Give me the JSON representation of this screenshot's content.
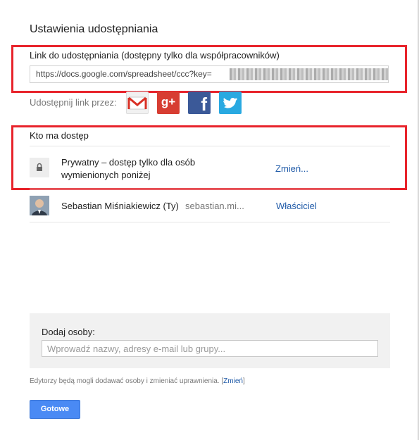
{
  "dialog": {
    "title": "Ustawienia udostępniania",
    "link_section": {
      "label": "Link do udostępniania (dostępny tylko dla współpracowników)",
      "url": "https://docs.google.com/spreadsheet/ccc?key="
    },
    "share_via": {
      "label": "Udostępnij link przez:",
      "services": [
        "gmail-icon",
        "google-plus-icon",
        "facebook-icon",
        "twitter-icon"
      ],
      "gplus_text": "g+",
      "fb_text": "f"
    },
    "access": {
      "label": "Kto ma dostęp",
      "privacy_line1": "Prywatny – dostęp tylko dla osób",
      "privacy_line2": "wymienionych poniżej",
      "change_label": "Zmień...",
      "owner_name": "Sebastian Miśniakiewicz (Ty)",
      "owner_email": "sebastian.mi...",
      "owner_role": "Właściciel"
    },
    "add_people": {
      "label": "Dodaj osoby:",
      "placeholder": "Wprowadź nazwy, adresy e-mail lub grupy..."
    },
    "footnote": {
      "text": "Edytorzy będą mogli dodawać osoby i zmieniać uprawnienia.",
      "bracket_open": "[",
      "change_link": "Zmień",
      "bracket_close": "]"
    },
    "done_button": "Gotowe"
  },
  "colors": {
    "highlight_red": "#e8232b",
    "link_blue": "#1f5aa8",
    "button_blue": "#4a8af4"
  }
}
